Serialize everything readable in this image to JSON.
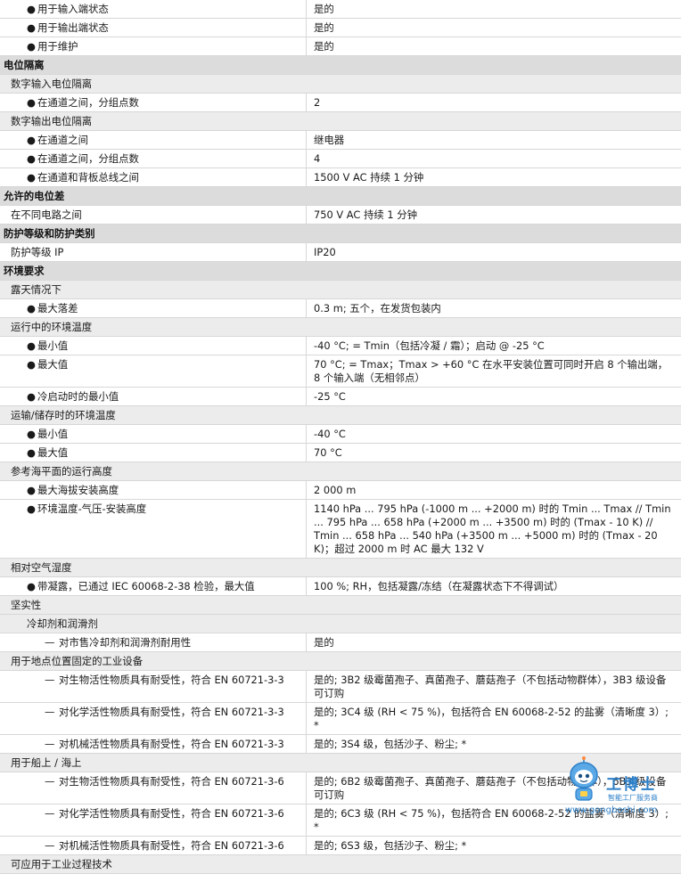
{
  "rows": [
    {
      "t": "item",
      "mk": "dot",
      "label": "用于输入端状态",
      "value": "是的"
    },
    {
      "t": "item",
      "mk": "dot",
      "label": "用于输出端状态",
      "value": "是的"
    },
    {
      "t": "item",
      "mk": "dot",
      "label": "用于维护",
      "value": "是的"
    },
    {
      "t": "h1",
      "label": "电位隔离",
      "value": ""
    },
    {
      "t": "h2",
      "label": "数字输入电位隔离",
      "value": ""
    },
    {
      "t": "item",
      "mk": "dot",
      "label": "在通道之间，分组点数",
      "value": "2"
    },
    {
      "t": "h2",
      "label": "数字输出电位隔离",
      "value": ""
    },
    {
      "t": "item",
      "mk": "dot",
      "label": "在通道之间",
      "value": "继电器"
    },
    {
      "t": "item",
      "mk": "dot",
      "label": "在通道之间，分组点数",
      "value": "4"
    },
    {
      "t": "item",
      "mk": "dot",
      "label": "在通道和背板总线之间",
      "value": "1500 V AC 持续 1 分钟"
    },
    {
      "t": "h1",
      "label": "允许的电位差",
      "value": ""
    },
    {
      "t": "item",
      "mk": "",
      "label": "在不同电路之间",
      "value": "750 V AC 持续 1 分钟"
    },
    {
      "t": "h1",
      "label": "防护等级和防护类别",
      "value": ""
    },
    {
      "t": "item",
      "mk": "",
      "label": "防护等级 IP",
      "value": "IP20"
    },
    {
      "t": "h1",
      "label": "环境要求",
      "value": ""
    },
    {
      "t": "h2",
      "label": "露天情况下",
      "value": ""
    },
    {
      "t": "item",
      "mk": "dot",
      "label": "最大落差",
      "value": "0.3 m; 五个，在发货包装内"
    },
    {
      "t": "h2",
      "label": "运行中的环境温度",
      "value": ""
    },
    {
      "t": "item",
      "mk": "dot",
      "label": "最小值",
      "value": "-40 °C; = Tmin（包括冷凝 / 霜）；启动 @ -25 °C"
    },
    {
      "t": "item",
      "mk": "dot",
      "label": "最大值",
      "value": "70 °C; = Tmax；Tmax > +60 °C 在水平安装位置可同时开启 8 个输出端，8 个输入端（无相邻点）"
    },
    {
      "t": "item",
      "mk": "dot",
      "label": "冷启动时的最小值",
      "value": "-25 °C"
    },
    {
      "t": "h2",
      "label": "运输/储存时的环境温度",
      "value": ""
    },
    {
      "t": "item",
      "mk": "dot",
      "label": "最小值",
      "value": "-40 °C"
    },
    {
      "t": "item",
      "mk": "dot",
      "label": "最大值",
      "value": "70 °C"
    },
    {
      "t": "h2",
      "label": "参考海平面的运行高度",
      "value": ""
    },
    {
      "t": "item",
      "mk": "dot",
      "label": "最大海拔安装高度",
      "value": "2 000 m"
    },
    {
      "t": "item",
      "mk": "dot",
      "label": "环境温度-气压-安装高度",
      "value": "1140 hPa ... 795 hPa (-1000 m ... +2000 m) 时的 Tmin ... Tmax // Tmin ... 795 hPa ... 658 hPa (+2000 m ... +3500 m) 时的 (Tmax - 10 K) // Tmin ... 658 hPa ... 540 hPa (+3500 m ... +5000 m) 时的 (Tmax - 20 K)；超过 2000 m 时 AC 最大 132 V"
    },
    {
      "t": "h2",
      "label": "相对空气湿度",
      "value": ""
    },
    {
      "t": "item",
      "mk": "dot",
      "label": "带凝露，已通过 IEC 60068-2-38 检验，最大值",
      "value": "100 %; RH，包括凝露/冻结（在凝露状态下不得调试）"
    },
    {
      "t": "h2",
      "label": "坚实性",
      "value": ""
    },
    {
      "t": "h2",
      "ind": true,
      "label": "冷却剂和润滑剂",
      "value": ""
    },
    {
      "t": "item",
      "lv": 2,
      "mk": "dash",
      "label": "对市售冷却剂和润滑剂耐用性",
      "value": "是的"
    },
    {
      "t": "h2",
      "label": "用于地点位置固定的工业设备",
      "value": ""
    },
    {
      "t": "item",
      "lv": 2,
      "mk": "dash",
      "label": "对生物活性物质具有耐受性，符合 EN 60721-3-3",
      "value": "是的; 3B2 级霉菌孢子、真菌孢子、蘑菇孢子（不包括动物群体），3B3 级设备可订购"
    },
    {
      "t": "item",
      "lv": 2,
      "mk": "dash",
      "label": "对化学活性物质具有耐受性，符合 EN 60721-3-3",
      "value": "是的; 3C4 级 (RH < 75 %)，包括符合 EN 60068-2-52 的盐雾（清晰度 3）; *"
    },
    {
      "t": "item",
      "lv": 2,
      "mk": "dash",
      "label": "对机械活性物质具有耐受性，符合 EN 60721-3-3",
      "value": "是的; 3S4 级，包括沙子、粉尘; *"
    },
    {
      "t": "h2",
      "label": "用于船上 / 海上",
      "value": ""
    },
    {
      "t": "item",
      "lv": 2,
      "mk": "dash",
      "label": "对生物活性物质具有耐受性，符合 EN 60721-3-6",
      "value": "是的; 6B2 级霉菌孢子、真菌孢子、蘑菇孢子（不包括动物群体），6B3 级设备可订购"
    },
    {
      "t": "item",
      "lv": 2,
      "mk": "dash",
      "label": "对化学活性物质具有耐受性，符合 EN 60721-3-6",
      "value": "是的; 6C3 级 (RH < 75 %)，包括符合 EN 60068-2-52 的盐雾（清晰度 3）; *"
    },
    {
      "t": "item",
      "lv": 2,
      "mk": "dash",
      "label": "对机械活性物质具有耐受性，符合 EN 60721-3-6",
      "value": "是的; 6S3 级，包括沙子、粉尘; *"
    },
    {
      "t": "h2",
      "label": "可应用于工业过程技术",
      "value": ""
    }
  ],
  "markers": {
    "dot": "●",
    "dash": "—"
  },
  "watermark": {
    "brand": "工博士",
    "tagline": "智能工厂服务商",
    "url": "www.gongboshi.com",
    "color": "#2c7fc8"
  }
}
